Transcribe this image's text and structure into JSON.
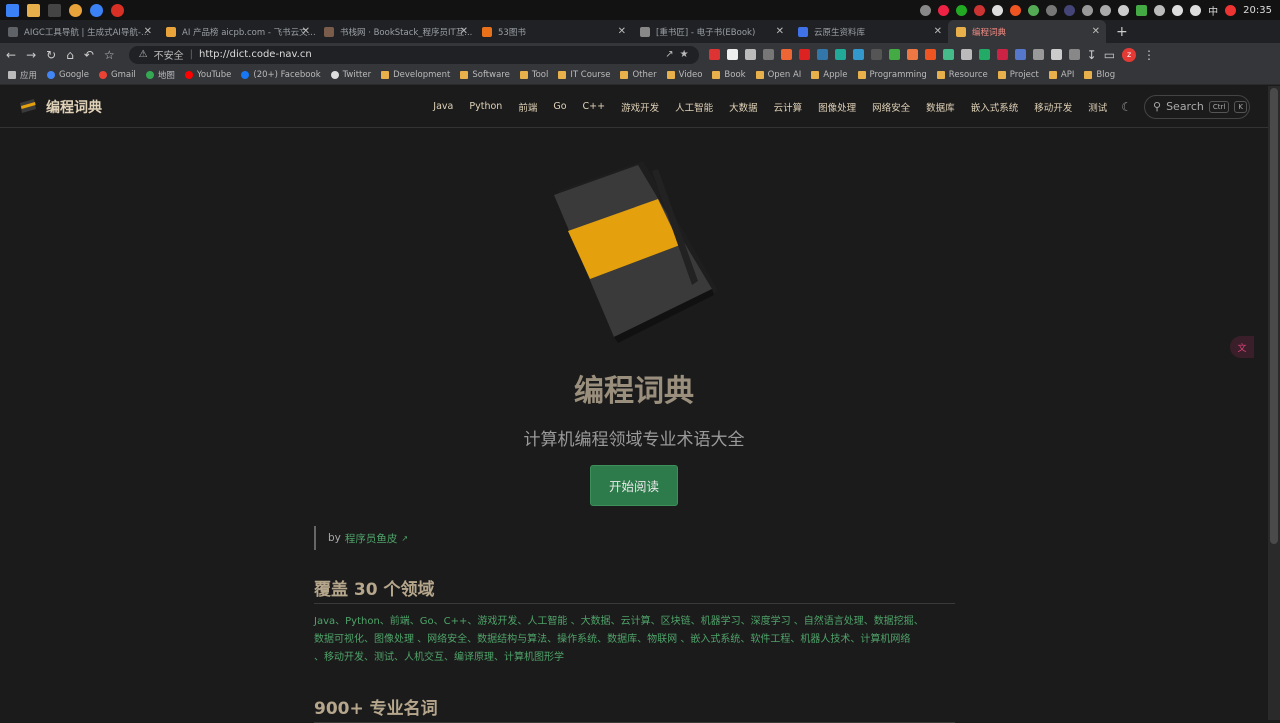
{
  "taskbar": {
    "clock": "20:35",
    "ime": "中"
  },
  "tabs": [
    {
      "title": "AIGC工具导航 | 生成式AI导航-...",
      "color": "#5f6368"
    },
    {
      "title": "AI 产品榜 aicpb.com - 飞书云文...",
      "color": "#e8a33a"
    },
    {
      "title": "书栈网 · BookStack_程序员IT互...",
      "color": "#7a5c4a"
    },
    {
      "title": "53图书",
      "color": "#e8711a"
    },
    {
      "title": "[重书匠] - 电子书(EBook)",
      "color": "#888888"
    },
    {
      "title": "云原生资料库",
      "color": "#3f71e8"
    },
    {
      "title": "编程词典",
      "color": "#e8b04a"
    }
  ],
  "toolbar": {
    "security": "不安全",
    "url": "http://dict.code-nav.cn",
    "avatar": "z"
  },
  "bookmarks": [
    {
      "label": "应用",
      "type": "apps"
    },
    {
      "label": "Google",
      "type": "site",
      "color": "#4285f4"
    },
    {
      "label": "Gmail",
      "type": "site",
      "color": "#ea4335"
    },
    {
      "label": "地图",
      "type": "site",
      "color": "#34a853"
    },
    {
      "label": "YouTube",
      "type": "site",
      "color": "#ff0000"
    },
    {
      "label": "(20+) Facebook",
      "type": "site",
      "color": "#1877f2"
    },
    {
      "label": "Twitter",
      "type": "site",
      "color": "#dddddd"
    },
    {
      "label": "Development",
      "type": "folder"
    },
    {
      "label": "Software",
      "type": "folder"
    },
    {
      "label": "Tool",
      "type": "folder"
    },
    {
      "label": "IT Course",
      "type": "folder"
    },
    {
      "label": "Other",
      "type": "folder"
    },
    {
      "label": "Video",
      "type": "folder"
    },
    {
      "label": "Book",
      "type": "folder"
    },
    {
      "label": "Open AI",
      "type": "folder"
    },
    {
      "label": "Apple",
      "type": "folder"
    },
    {
      "label": "Programming",
      "type": "folder"
    },
    {
      "label": "Resource",
      "type": "folder"
    },
    {
      "label": "Project",
      "type": "folder"
    },
    {
      "label": "API",
      "type": "folder"
    },
    {
      "label": "Blog",
      "type": "folder"
    }
  ],
  "site": {
    "brand": "编程词典",
    "nav": [
      "Java",
      "Python",
      "前端",
      "Go",
      "C++",
      "游戏开发",
      "人工智能",
      "大数据",
      "云计算",
      "图像处理",
      "网络安全",
      "数据库",
      "嵌入式系统",
      "移动开发",
      "测试"
    ],
    "search_label": "Search",
    "search_kbd1": "Ctrl",
    "search_kbd2": "K",
    "title": "编程词典",
    "tagline": "计算机编程领域专业术语大全",
    "cta": "开始阅读",
    "quote_by": "by",
    "quote_author": "程序员鱼皮",
    "section1": "覆盖 30 个领域",
    "domains_line1": "Java、Python、前端、Go、C++、游戏开发、人工智能 、大数据、云计算、区块链、机器学习、深度学习 、自然语言处理、数据挖掘、",
    "domains_line2": "数据可视化、图像处理 、网络安全、数据结构与算法、操作系统、数据库、物联网 、嵌入式系统、软件工程、机器人技术、计算机网络",
    "domains_line3": "、移动开发、测试、人机交互、编译原理、计算机图形学",
    "section2": "900+ 专业名词"
  },
  "colors": {
    "accent_green": "#4fa369",
    "cta_bg": "#2d7a4a",
    "book_yellow": "#e5a00d"
  }
}
